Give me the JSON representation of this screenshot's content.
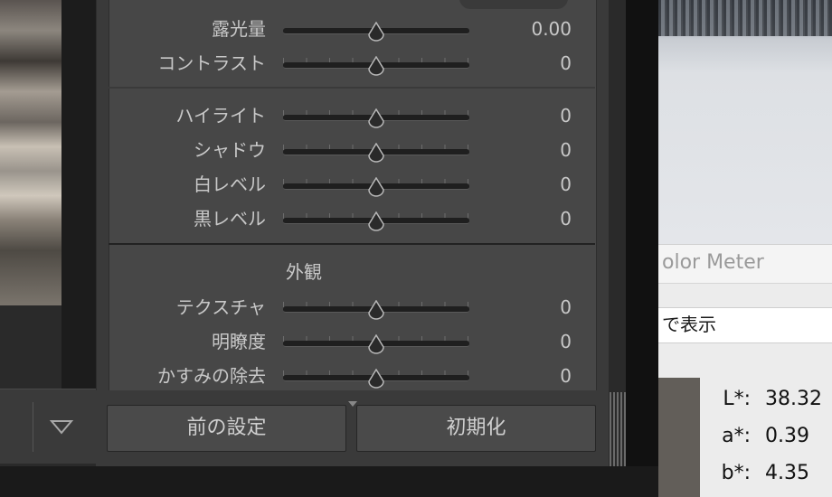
{
  "panel": {
    "basic_rows": [
      {
        "label": "露光量",
        "value": "0.00"
      },
      {
        "label": "コントラスト",
        "value": "0"
      }
    ],
    "tone_rows": [
      {
        "label": "ハイライト",
        "value": "0"
      },
      {
        "label": "シャドウ",
        "value": "0"
      },
      {
        "label": "白レベル",
        "value": "0"
      },
      {
        "label": "黒レベル",
        "value": "0"
      }
    ],
    "presence_title": "外観",
    "presence_rows": [
      {
        "label": "テクスチャ",
        "value": "0"
      },
      {
        "label": "明瞭度",
        "value": "0"
      },
      {
        "label": "かすみの除去",
        "value": "0"
      }
    ],
    "buttons": {
      "previous": "前の設定",
      "reset": "初期化"
    }
  },
  "color_meter": {
    "title": "olor Meter",
    "display_mode": "で表示",
    "readings": [
      {
        "label": "L*:",
        "value": "38.32"
      },
      {
        "label": "a*:",
        "value": "0.39"
      },
      {
        "label": "b*:",
        "value": "4.35"
      }
    ],
    "swatch_color": "#625e59"
  },
  "icons": {
    "dropdown": "triangle-down-icon",
    "slider_thumb": "droplet-thumb-icon",
    "panel_collapse": "caret-down-icon"
  }
}
